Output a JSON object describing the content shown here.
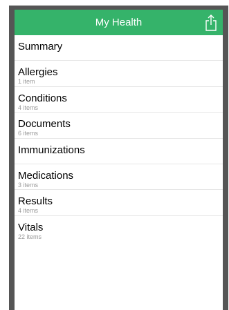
{
  "navbar": {
    "title": "My Health",
    "share_icon": "share-icon"
  },
  "colors": {
    "accent": "#35b36a",
    "frame": "#555555"
  },
  "items": [
    {
      "label": "Summary",
      "sub": ""
    },
    {
      "label": "Allergies",
      "sub": "1 item"
    },
    {
      "label": "Conditions",
      "sub": "4 items"
    },
    {
      "label": "Documents",
      "sub": "6 items"
    },
    {
      "label": "Immunizations",
      "sub": ""
    },
    {
      "label": "Medications",
      "sub": "3 items"
    },
    {
      "label": "Results",
      "sub": "4 items"
    },
    {
      "label": "Vitals",
      "sub": "22 items"
    }
  ]
}
